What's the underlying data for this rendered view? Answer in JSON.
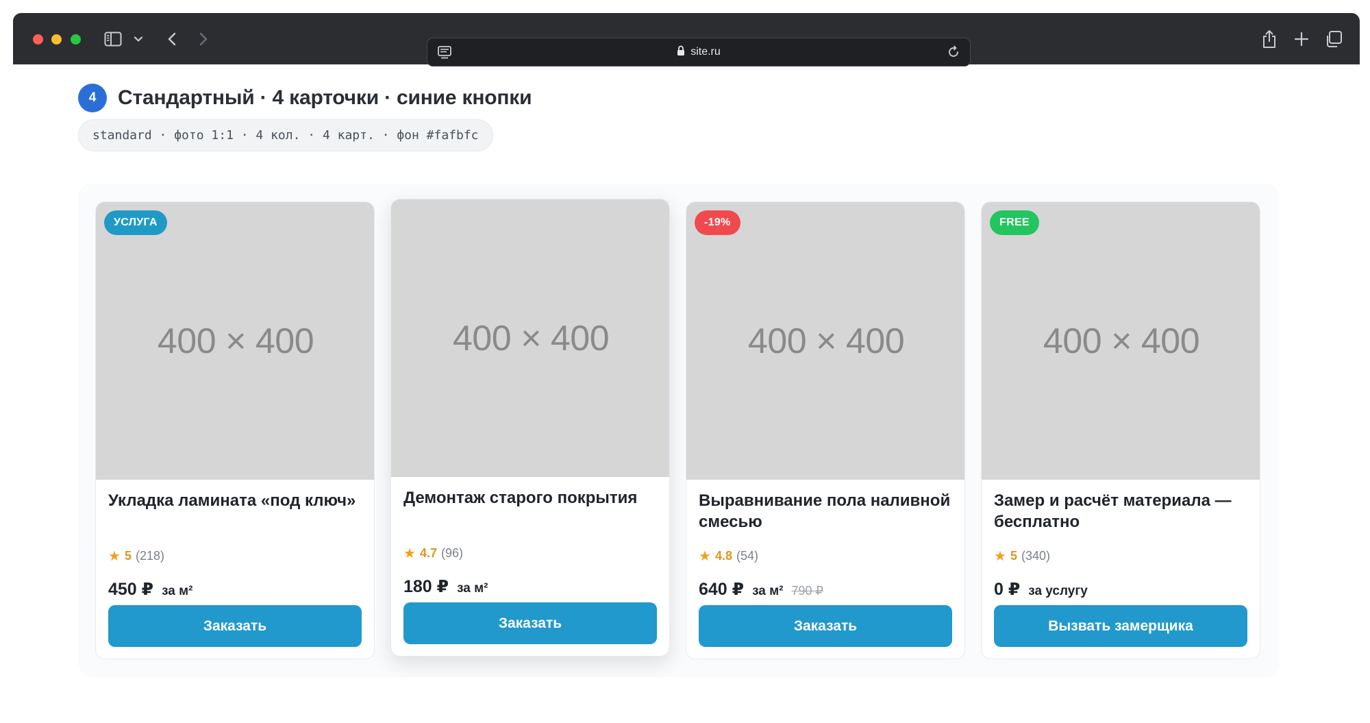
{
  "browser": {
    "url": "site.ru"
  },
  "section": {
    "number": "4",
    "title": "Стандартный · 4 карточки · синие кнопки",
    "spec": "standard · фото 1:1 · 4 кол. · 4 карт. · фон #fafbfc"
  },
  "cards": [
    {
      "badge": "УСЛУГА",
      "badge_color": "#1f9ac6",
      "photo_label": "400 × 400",
      "title": "Укладка ламината «под ключ»",
      "rating": "5",
      "reviews": "(218)",
      "price": "450 ₽",
      "unit": "за м²",
      "old_price": "",
      "button": "Заказать"
    },
    {
      "badge": "",
      "photo_label": "400 × 400",
      "title": "Демонтаж старого покрытия",
      "rating": "4.7",
      "reviews": "(96)",
      "price": "180 ₽",
      "unit": "за м²",
      "old_price": "",
      "button": "Заказать"
    },
    {
      "badge": "-19%",
      "badge_color": "#f04a4f",
      "photo_label": "400 × 400",
      "title": "Выравнивание пола наливной смесью",
      "rating": "4.8",
      "reviews": "(54)",
      "price": "640 ₽",
      "unit": "за м²",
      "old_price": "790 ₽",
      "button": "Заказать"
    },
    {
      "badge": "FREE",
      "badge_color": "#22c55e",
      "photo_label": "400 × 400",
      "title": "Замер и расчёт материала — бесплатно",
      "rating": "5",
      "reviews": "(340)",
      "price": "0 ₽",
      "unit": "за услугу",
      "old_price": "",
      "button": "Вызвать замерщика"
    }
  ],
  "colors": {
    "button": "#2199cc",
    "step_badge": "#2b6fd6",
    "area_background": "#fafbfc",
    "star": "#f0a11b"
  }
}
